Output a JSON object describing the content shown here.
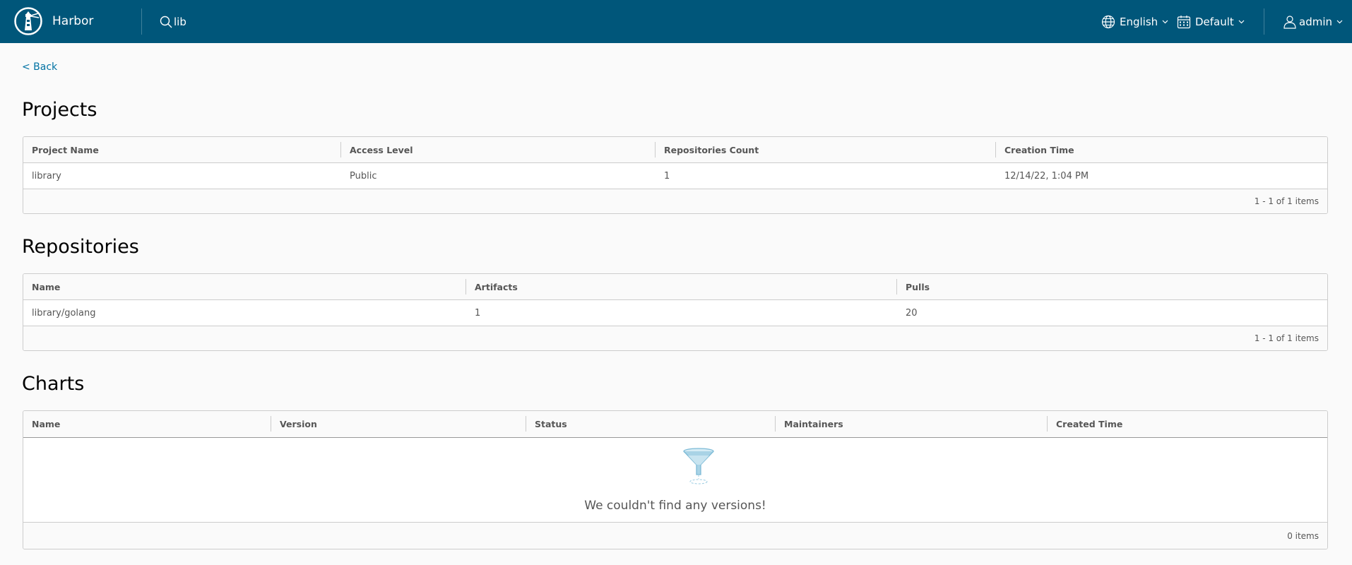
{
  "header": {
    "brand": "Harbor",
    "search_value": "lib",
    "language": "English",
    "datetime_format": "Default",
    "user": "admin",
    "bg_color": "#00567a"
  },
  "back_label": "< Back",
  "projects": {
    "title": "Projects",
    "columns": [
      "Project Name",
      "Access Level",
      "Repositories Count",
      "Creation Time"
    ],
    "rows": [
      {
        "name": "library",
        "access": "Public",
        "repo_count": "1",
        "created": "12/14/22, 1:04 PM"
      }
    ],
    "footer": "1 - 1 of 1 items"
  },
  "repositories": {
    "title": "Repositories",
    "columns": [
      "Name",
      "Artifacts",
      "Pulls"
    ],
    "rows": [
      {
        "name": "library/golang",
        "artifacts": "1",
        "pulls": "20"
      }
    ],
    "footer": "1 - 1 of 1 items"
  },
  "charts": {
    "title": "Charts",
    "columns": [
      "Name",
      "Version",
      "Status",
      "Maintainers",
      "Created Time"
    ],
    "empty_message": "We couldn't find any versions!",
    "footer": "0 items"
  },
  "icons": {
    "logo": "harbor-lighthouse-logo",
    "search": "search-icon",
    "language": "globe-icon",
    "datetime": "calendar-icon",
    "user": "user-icon",
    "empty": "funnel-icon"
  }
}
